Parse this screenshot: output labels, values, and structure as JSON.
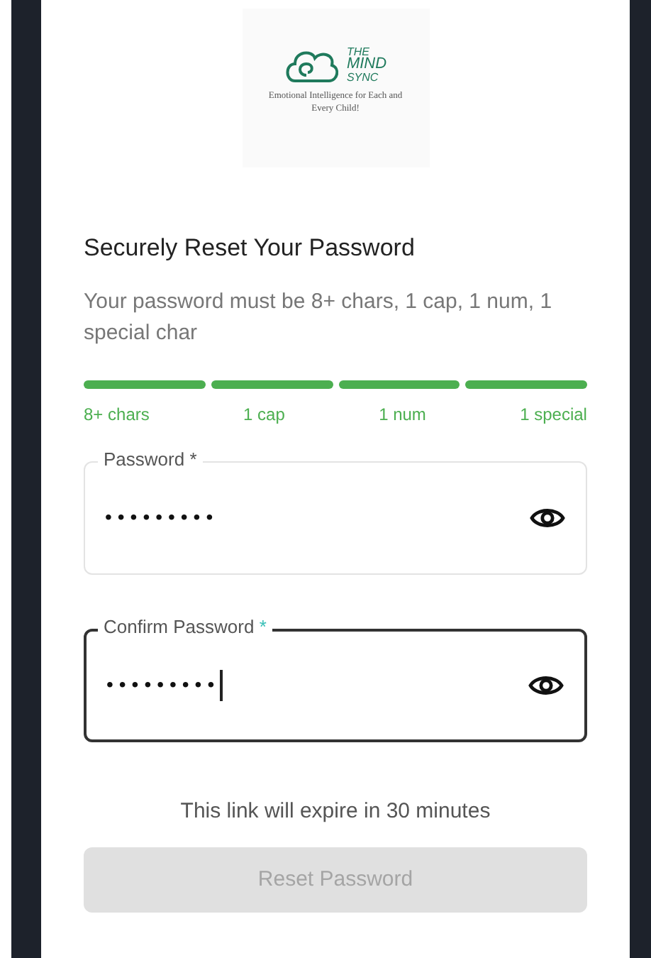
{
  "logo": {
    "words": [
      "THE",
      "MIND",
      "SYNC"
    ],
    "tagline": "Emotional Intelligence for Each and Every Child!"
  },
  "title": "Securely Reset Your Password",
  "description": "Your password must be 8+ chars, 1 cap, 1 num, 1 special char",
  "requirements": [
    {
      "label": "8+ chars",
      "met": true
    },
    {
      "label": "1 cap",
      "met": true
    },
    {
      "label": "1 num",
      "met": true
    },
    {
      "label": "1 special",
      "met": true
    }
  ],
  "fields": [
    {
      "label": "Password",
      "required_mark": "*",
      "value": "•••••••••",
      "focused": false
    },
    {
      "label": "Confirm Password",
      "required_mark": "*",
      "value": "•••••••••",
      "focused": true
    }
  ],
  "expiry_note": "This link will expire in 30 minutes",
  "submit": {
    "label": "Reset Password",
    "disabled": true
  }
}
